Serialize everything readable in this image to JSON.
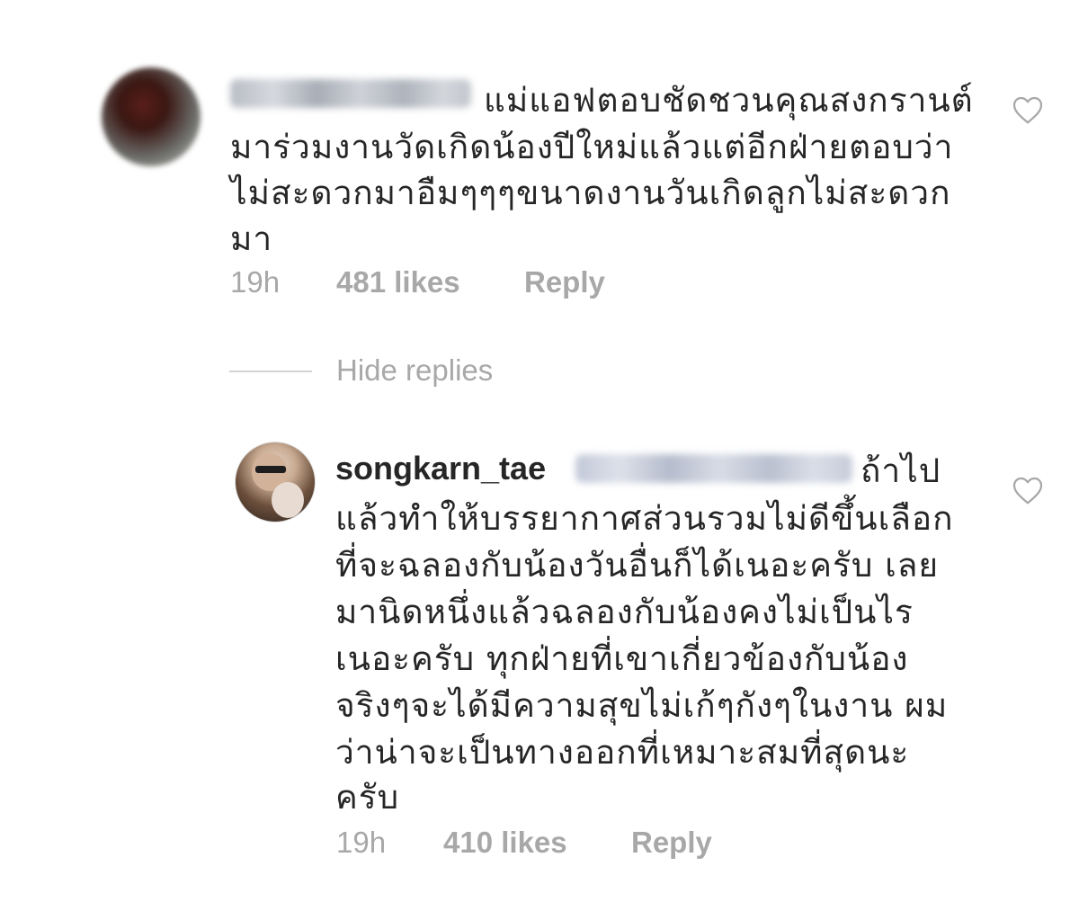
{
  "comment": {
    "username_blurred": true,
    "text_lines": [
      "แม่แอฟตอบชัดชวนคุณสงกรานต์",
      "มาร่วมงานวัดเกิดน้องปีใหม่แล้วแต่อีกฝ่ายตอบว่า",
      "ไม่สะดวกมาอืมๆๆๆขนาดงานวันเกิดลูกไม่สะดวก",
      "มา"
    ],
    "time": "19h",
    "likes": "481 likes",
    "reply_label": "Reply",
    "like_icon": "heart-outline-icon"
  },
  "hide_replies": {
    "label": "Hide replies"
  },
  "reply": {
    "username": "songkarn_tae",
    "mention_blurred": true,
    "text_lines": [
      "ถ้าไป",
      "แล้วทำให้บรรยากาศส่วนรวมไม่ดีขึ้นเลือก",
      "ที่จะฉลองกับน้องวันอื่นก็ได้เนอะครับ เลย",
      "มานิดหนึ่งแล้วฉลองกับน้องคงไม่เป็นไร",
      "เนอะครับ ทุกฝ่ายที่เขาเกี่ยวข้องกับน้อง",
      "จริงๆจะได้มีความสุขไม่เก้ๆกังๆในงาน ผม",
      "ว่าน่าจะเป็นทางออกที่เหมาะสมที่สุดนะ",
      "ครับ"
    ],
    "time": "19h",
    "likes": "410 likes",
    "reply_label": "Reply",
    "like_icon": "heart-outline-icon"
  },
  "colors": {
    "text_primary": "#262626",
    "text_secondary": "#a8a8a8",
    "divider": "#d4d4d4",
    "background": "#ffffff"
  }
}
